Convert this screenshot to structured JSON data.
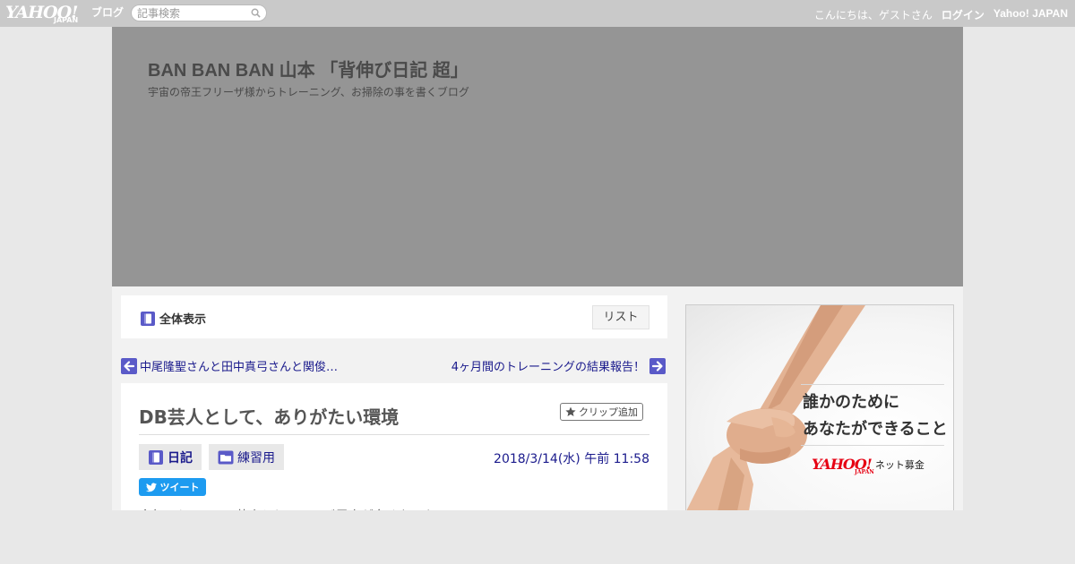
{
  "topbar": {
    "logo_text": "YAHOO!",
    "logo_sub": "JAPAN",
    "logo_blog": "ブログ",
    "search_placeholder": "記事検索",
    "greeting": "こんにちは、ゲストさん",
    "login": "ログイン",
    "yahoo_japan": "Yahoo! JAPAN"
  },
  "header": {
    "title": "BAN BAN BAN 山本 「背伸び日記 超」",
    "description": "宇宙の帝王フリーザ様からトレーニング、お掃除の事を書くブログ"
  },
  "nav": {
    "all_label": "全体表示",
    "list_label": "リスト"
  },
  "prevnext": {
    "prev": "中尾隆聖さんと田中真弓さんと関俊…",
    "next": "4ヶ月間のトレーニングの結果報告！"
  },
  "article": {
    "title": "DB芸人として、ありがたい環境",
    "clip": "クリップ追加",
    "category1": "日記",
    "category2": "練習用",
    "date": "2018/3/14(水) 午前 11:58",
    "tweet": "ツイート",
    "body_first_line": "今年に入って DB芸人としてテレビ露出が多くなった"
  },
  "ad": {
    "line1": "誰かのために",
    "line2": "あなたができること",
    "logo": "YAHOO!",
    "logo_sub": "JAPAN",
    "service": "ネット募金"
  },
  "colors": {
    "topbar": "#c9c9c9",
    "header_bg": "#959595",
    "link": "#1a1a8c",
    "accent_icon": "#5a5ac8",
    "tweet": "#1d9bf0"
  }
}
